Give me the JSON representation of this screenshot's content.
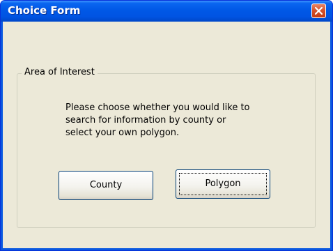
{
  "window": {
    "title": "Choice Form"
  },
  "title_bar_buttons": {
    "close_icon": "close-x-icon"
  },
  "group": {
    "legend": "Area of Interest",
    "message_lines": [
      "Please choose whether you would like to",
      "search for information by county or",
      "select your own polygon."
    ]
  },
  "buttons": {
    "county_label": "County",
    "polygon_label": "Polygon",
    "focused": "Polygon"
  },
  "colors": {
    "title_bar": "#0054e3",
    "close_button": "#d6532d",
    "dialog_background": "#ece9d8"
  }
}
